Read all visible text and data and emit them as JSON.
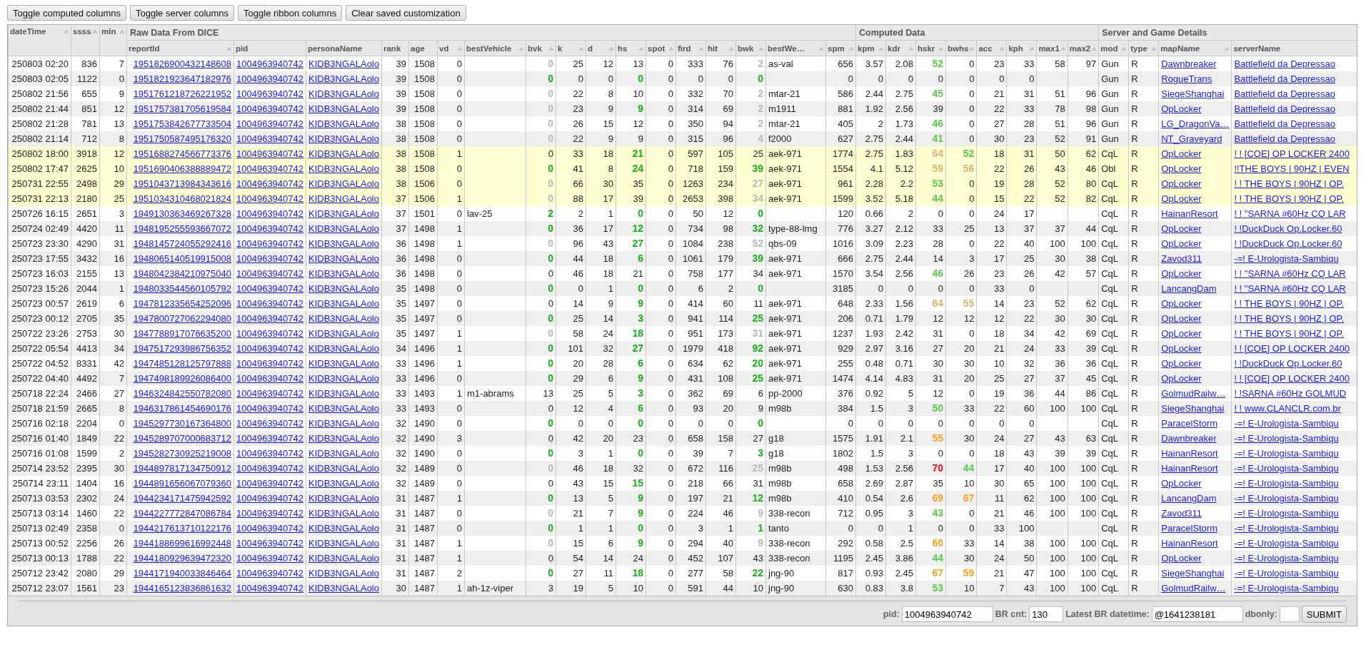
{
  "toolbar": {
    "buttons": [
      "Toggle computed columns",
      "Toggle server columns",
      "Toggle ribbon columns",
      "Clear saved customization"
    ]
  },
  "table": {
    "leading_columns": [
      {
        "label": "dateTime",
        "sortable": true,
        "kind": "number"
      },
      {
        "label": "ssss",
        "sortable": true,
        "kind": "number"
      },
      {
        "label": "min",
        "sortable": true,
        "kind": "number"
      }
    ],
    "groups": [
      {
        "label": "Raw Data From DICE",
        "columns": [
          {
            "label": "reportId",
            "sortable": true,
            "kind": "id-link"
          },
          {
            "label": "pid",
            "sortable": false,
            "kind": "link"
          },
          {
            "label": "personaName",
            "sortable": false,
            "kind": "link"
          },
          {
            "label": "rank",
            "sortable": false,
            "kind": "number"
          },
          {
            "label": "age",
            "sortable": false,
            "kind": "number"
          },
          {
            "label": "vd",
            "sortable": true,
            "kind": "number"
          },
          {
            "label": "bestVehicle",
            "sortable": true,
            "kind": "text"
          },
          {
            "label": "bvk",
            "sortable": true,
            "kind": "number"
          },
          {
            "label": "k",
            "sortable": true,
            "kind": "number"
          },
          {
            "label": "d",
            "sortable": true,
            "kind": "number"
          },
          {
            "label": "hs",
            "sortable": true,
            "kind": "number"
          },
          {
            "label": "spot",
            "sortable": true,
            "kind": "number"
          },
          {
            "label": "fird",
            "sortable": true,
            "kind": "number"
          },
          {
            "label": "hit",
            "sortable": true,
            "kind": "number"
          },
          {
            "label": "bwk",
            "sortable": true,
            "kind": "number"
          },
          {
            "label": "bestWe…",
            "sortable": true,
            "kind": "text"
          },
          {
            "label": "spm",
            "sortable": true,
            "kind": "number"
          }
        ]
      },
      {
        "label": "Computed Data",
        "columns": [
          {
            "label": "kpm",
            "sortable": true,
            "kind": "number"
          },
          {
            "label": "kdr",
            "sortable": true,
            "kind": "number"
          },
          {
            "label": "hskr",
            "sortable": true,
            "kind": "number"
          },
          {
            "label": "bwhs",
            "sortable": true,
            "kind": "number"
          },
          {
            "label": "acc",
            "sortable": true,
            "kind": "number"
          },
          {
            "label": "kph",
            "sortable": true,
            "kind": "number"
          },
          {
            "label": "max1",
            "sortable": true,
            "kind": "number"
          },
          {
            "label": "max2",
            "sortable": true,
            "kind": "number"
          }
        ]
      },
      {
        "label": "Server and Game Details",
        "columns": [
          {
            "label": "mod",
            "sortable": true,
            "kind": "text"
          },
          {
            "label": "type",
            "sortable": true,
            "kind": "text"
          },
          {
            "label": "mapName",
            "sortable": true,
            "kind": "link"
          },
          {
            "label": "serverName",
            "sortable": false,
            "kind": "link"
          }
        ]
      }
    ],
    "rows": [
      {
        "highlighted": false,
        "cells": [
          "250803 02:20",
          "836",
          "7",
          "1951826900432148608",
          "1004963940742",
          "KIDB3NGALAolo",
          "39",
          "1508",
          "0",
          null,
          {
            "text": "0",
            "color": "#b8b8b8"
          },
          "25",
          "12",
          "13",
          "0",
          "333",
          "76",
          {
            "text": "2",
            "color": "#b8b8b8"
          },
          "as-val",
          "656",
          "3.57",
          "2.08",
          {
            "text": "52",
            "color": "#5cc84e"
          },
          "0",
          "23",
          "33",
          "58",
          "97",
          "Gun",
          "R",
          "Dawnbreaker",
          "Battlefield da Depressao"
        ]
      },
      {
        "highlighted": false,
        "cells": [
          "250803 02:05",
          "1122",
          "0",
          "1951821923647182976",
          "1004963940742",
          "KIDB3NGALAolo",
          "39",
          "1508",
          "0",
          null,
          {
            "text": "0",
            "color": "#16b016"
          },
          "0",
          "0",
          {
            "text": "0",
            "color": "#16b016"
          },
          "0",
          "0",
          "0",
          {
            "text": "0",
            "color": "#16b016"
          },
          null,
          "0",
          "0",
          "0",
          "0",
          "0",
          "0",
          "0",
          null,
          null,
          "Gun",
          "R",
          "RogueTrans",
          "Battlefield da Depressao"
        ]
      },
      {
        "highlighted": false,
        "cells": [
          "250802 21:56",
          "655",
          "9",
          "1951761218726221952",
          "1004963940742",
          "KIDB3NGALAolo",
          "39",
          "1508",
          "0",
          null,
          {
            "text": "0",
            "color": "#b8b8b8"
          },
          "22",
          "8",
          "10",
          "0",
          "332",
          "70",
          {
            "text": "2",
            "color": "#b8b8b8"
          },
          "mtar-21",
          "586",
          "2.44",
          "2.75",
          {
            "text": "45",
            "color": "#5cc84e"
          },
          "0",
          "21",
          "31",
          "51",
          "96",
          "Gun",
          "R",
          "SiegeShanghai",
          "Battlefield da Depressao"
        ]
      },
      {
        "highlighted": false,
        "cells": [
          "250802 21:44",
          "851",
          "12",
          "1951757381705619584",
          "1004963940742",
          "KIDB3NGALAolo",
          "39",
          "1508",
          "0",
          null,
          {
            "text": "0",
            "color": "#b8b8b8"
          },
          "23",
          "9",
          {
            "text": "9",
            "color": "#16b016"
          },
          "0",
          "314",
          "69",
          {
            "text": "2",
            "color": "#b8b8b8"
          },
          "m1911",
          "881",
          "1.92",
          "2.56",
          "39",
          "0",
          "22",
          "33",
          "78",
          "98",
          "Gun",
          "R",
          "OpLocker",
          "Battlefield da Depressao"
        ]
      },
      {
        "highlighted": false,
        "cells": [
          "250802 21:28",
          "781",
          "13",
          "1951753842677733504",
          "1004963940742",
          "KIDB3NGALAolo",
          "38",
          "1508",
          "0",
          null,
          {
            "text": "0",
            "color": "#b8b8b8"
          },
          "26",
          "15",
          "12",
          "0",
          "350",
          "94",
          {
            "text": "2",
            "color": "#b8b8b8"
          },
          "mtar-21",
          "405",
          "2",
          "1.73",
          {
            "text": "46",
            "color": "#5cc84e"
          },
          "0",
          "27",
          "28",
          "51",
          "96",
          "Gun",
          "R",
          "LG_DragonVa…",
          "Battlefield da Depressao"
        ]
      },
      {
        "highlighted": false,
        "cells": [
          "250802 21:14",
          "712",
          "8",
          "1951750587495176320",
          "1004963940742",
          "KIDB3NGALAolo",
          "38",
          "1508",
          "0",
          null,
          {
            "text": "0",
            "color": "#b8b8b8"
          },
          "22",
          "9",
          "9",
          "0",
          "315",
          "96",
          {
            "text": "4",
            "color": "#b8b8b8"
          },
          "f2000",
          "627",
          "2.75",
          "2.44",
          {
            "text": "41",
            "color": "#5cc84e"
          },
          "0",
          "30",
          "23",
          "52",
          "91",
          "Gun",
          "R",
          "NT_Graveyard",
          "Battlefield da Depressao"
        ]
      },
      {
        "highlighted": true,
        "cells": [
          "250802 18:00",
          "3918",
          "12",
          "1951688274566773376",
          "1004963940742",
          "KIDB3NGALAolo",
          "38",
          "1508",
          "1",
          null,
          "0",
          "33",
          "18",
          {
            "text": "21",
            "color": "#16b016"
          },
          "0",
          "597",
          "105",
          "25",
          "aek-971",
          "1774",
          "2.75",
          "1.83",
          {
            "text": "64",
            "color": "#d9b473"
          },
          {
            "text": "52",
            "color": "#5cc84e"
          },
          "18",
          "31",
          "50",
          "62",
          "CqL",
          "R",
          "OpLocker",
          "! ! [COE] OP LOCKER 2400"
        ]
      },
      {
        "highlighted": true,
        "cells": [
          "250802 17:47",
          "2625",
          "10",
          "1951690406388889472",
          "1004963940742",
          "KIDB3NGALAolo",
          "38",
          "1508",
          "0",
          null,
          {
            "text": "0",
            "color": "#16b016"
          },
          "41",
          "8",
          {
            "text": "24",
            "color": "#16b016"
          },
          "0",
          "718",
          "159",
          {
            "text": "39",
            "color": "#16b016"
          },
          "aek-971",
          "1554",
          "4.1",
          "5.12",
          {
            "text": "59",
            "color": "#d9b473"
          },
          {
            "text": "56",
            "color": "#d9b473"
          },
          "22",
          "26",
          "43",
          "46",
          "Obl",
          "R",
          "OpLocker",
          "!!THE BOYS | 90HZ | EVEN"
        ]
      },
      {
        "highlighted": true,
        "cells": [
          "250731 22:55",
          "2498",
          "29",
          "1951043713984343616",
          "1004963940742",
          "KIDB3NGALAolo",
          "38",
          "1506",
          "0",
          null,
          {
            "text": "0",
            "color": "#b8b8b8"
          },
          "66",
          "30",
          "35",
          "0",
          "1263",
          "234",
          {
            "text": "27",
            "color": "#b8b8b8"
          },
          "aek-971",
          "961",
          "2.28",
          "2.2",
          {
            "text": "53",
            "color": "#5cc84e"
          },
          "0",
          "19",
          "28",
          "52",
          "80",
          "CqL",
          "R",
          "OpLocker",
          "! ! THE BOYS | 90HZ | OP."
        ]
      },
      {
        "highlighted": true,
        "cells": [
          "250731 22:13",
          "2180",
          "25",
          "1951034310468021824",
          "1004963940742",
          "KIDB3NGALAolo",
          "37",
          "1506",
          "1",
          null,
          {
            "text": "0",
            "color": "#b8b8b8"
          },
          "88",
          "17",
          "39",
          "0",
          "2653",
          "398",
          {
            "text": "34",
            "color": "#b8b8b8"
          },
          "aek-971",
          "1599",
          "3.52",
          "5.18",
          {
            "text": "44",
            "color": "#5cc84e"
          },
          "0",
          "15",
          "22",
          "52",
          "82",
          "CqL",
          "R",
          "OpLocker",
          "! ! THE BOYS | 90HZ | OP."
        ]
      },
      {
        "highlighted": false,
        "cells": [
          "250726 16:15",
          "2651",
          "3",
          "1949130363469267328",
          "1004963940742",
          "KIDB3NGALAolo",
          "37",
          "1501",
          "0",
          "lav-25",
          {
            "text": "2",
            "color": "#16b016"
          },
          "2",
          "1",
          {
            "text": "0",
            "color": "#16b016"
          },
          "0",
          "50",
          "12",
          {
            "text": "0",
            "color": "#16b016"
          },
          null,
          "120",
          "0.66",
          "2",
          "0",
          "0",
          "24",
          "17",
          null,
          null,
          "CqL",
          "R",
          "HainanResort",
          "! ! \"SARNA #60Hz CQ LAR"
        ]
      },
      {
        "highlighted": false,
        "cells": [
          "250724 02:49",
          "4420",
          "11",
          "1948195255593667072",
          "1004963940742",
          "KIDB3NGALAolo",
          "37",
          "1498",
          "1",
          null,
          {
            "text": "0",
            "color": "#16b016"
          },
          "36",
          "17",
          {
            "text": "12",
            "color": "#16b016"
          },
          "0",
          "734",
          "98",
          {
            "text": "32",
            "color": "#16b016"
          },
          "type-88-lmg",
          "776",
          "3.27",
          "2.12",
          "33",
          "25",
          "13",
          "37",
          "37",
          "44",
          "CqL",
          "R",
          "OpLocker",
          "! !DuckDuck Op.Locker.60"
        ]
      },
      {
        "highlighted": false,
        "cells": [
          "250723 23:30",
          "4290",
          "31",
          "1948145724055292416",
          "1004963940742",
          "KIDB3NGALAolo",
          "36",
          "1498",
          "1",
          null,
          {
            "text": "0",
            "color": "#b8b8b8"
          },
          "96",
          "43",
          {
            "text": "27",
            "color": "#16b016"
          },
          "0",
          "1084",
          "238",
          {
            "text": "52",
            "color": "#b8b8b8"
          },
          "qbs-09",
          "1016",
          "3.09",
          "2.23",
          "28",
          "0",
          "22",
          "40",
          "100",
          "100",
          "CqL",
          "R",
          "OpLocker",
          "! !DuckDuck Op.Locker.60"
        ]
      },
      {
        "highlighted": false,
        "cells": [
          "250723 17:55",
          "3432",
          "16",
          "1948065140519915008",
          "1004963940742",
          "KIDB3NGALAolo",
          "36",
          "1498",
          "0",
          null,
          {
            "text": "0",
            "color": "#16b016"
          },
          "44",
          "18",
          {
            "text": "6",
            "color": "#16b016"
          },
          "0",
          "1061",
          "179",
          {
            "text": "39",
            "color": "#16b016"
          },
          "aek-971",
          "666",
          "2.75",
          "2.44",
          "14",
          "3",
          "17",
          "25",
          "30",
          "38",
          "CqL",
          "R",
          "Zavod311",
          "-=! E-Urologista-Sambiqu"
        ]
      },
      {
        "highlighted": false,
        "cells": [
          "250723 16:03",
          "2155",
          "13",
          "1948042384210975040",
          "1004963940742",
          "KIDB3NGALAolo",
          "36",
          "1498",
          "0",
          null,
          "0",
          "46",
          "18",
          "21",
          "0",
          "758",
          "177",
          "34",
          "aek-971",
          "1570",
          "3.54",
          "2.56",
          {
            "text": "46",
            "color": "#5cc84e"
          },
          "26",
          "23",
          "26",
          "42",
          "57",
          "CqL",
          "R",
          "OpLocker",
          "! ! \"SARNA #60Hz CQ LAR"
        ]
      },
      {
        "highlighted": false,
        "cells": [
          "250723 15:26",
          "2044",
          "1",
          "1948033544560105792",
          "1004963940742",
          "KIDB3NGALAolo",
          "35",
          "1498",
          "0",
          null,
          {
            "text": "0",
            "color": "#16b016"
          },
          "0",
          "1",
          {
            "text": "0",
            "color": "#16b016"
          },
          "0",
          "6",
          "2",
          {
            "text": "0",
            "color": "#16b016"
          },
          null,
          "3185",
          "0",
          "0",
          "0",
          "0",
          "33",
          "0",
          null,
          null,
          "CqL",
          "R",
          "LancangDam",
          "! ! \"SARNA #60Hz CQ LAR"
        ]
      },
      {
        "highlighted": false,
        "cells": [
          "250723 00:57",
          "2619",
          "6",
          "1947812335654252096",
          "1004963940742",
          "KIDB3NGALAolo",
          "35",
          "1497",
          "0",
          null,
          "0",
          "14",
          "9",
          {
            "text": "9",
            "color": "#16b016"
          },
          "0",
          "414",
          "60",
          "11",
          "aek-971",
          "648",
          "2.33",
          "1.56",
          {
            "text": "64",
            "color": "#d9b473"
          },
          {
            "text": "55",
            "color": "#d9b473"
          },
          "14",
          "23",
          "52",
          "62",
          "CqL",
          "R",
          "OpLocker",
          "! ! THE BOYS | 90HZ | OP."
        ]
      },
      {
        "highlighted": false,
        "cells": [
          "250723 00:12",
          "2705",
          "35",
          "1947800727062294080",
          "1004963940742",
          "KIDB3NGALAolo",
          "35",
          "1497",
          "0",
          null,
          {
            "text": "0",
            "color": "#16b016"
          },
          "25",
          "14",
          {
            "text": "3",
            "color": "#16b016"
          },
          "0",
          "941",
          "114",
          {
            "text": "25",
            "color": "#16b016"
          },
          "aek-971",
          "206",
          "0.71",
          "1.79",
          "12",
          "12",
          "12",
          "22",
          "30",
          "30",
          "CqL",
          "R",
          "OpLocker",
          "! ! THE BOYS | 90HZ | OP."
        ]
      },
      {
        "highlighted": false,
        "cells": [
          "250722 23:26",
          "2753",
          "30",
          "1947788917076635200",
          "1004963940742",
          "KIDB3NGALAolo",
          "35",
          "1497",
          "1",
          null,
          {
            "text": "0",
            "color": "#b8b8b8"
          },
          "58",
          "24",
          {
            "text": "18",
            "color": "#16b016"
          },
          "0",
          "951",
          "173",
          {
            "text": "31",
            "color": "#b8b8b8"
          },
          "aek-971",
          "1237",
          "1.93",
          "2.42",
          "31",
          "0",
          "18",
          "34",
          "42",
          "69",
          "CqL",
          "R",
          "OpLocker",
          "! ! THE BOYS | 90HZ | OP."
        ]
      },
      {
        "highlighted": false,
        "cells": [
          "250722 05:54",
          "4413",
          "34",
          "1947517293986756352",
          "1004963940742",
          "KIDB3NGALAolo",
          "34",
          "1496",
          "1",
          null,
          {
            "text": "0",
            "color": "#16b016"
          },
          "101",
          "32",
          {
            "text": "27",
            "color": "#16b016"
          },
          "0",
          "1979",
          "418",
          {
            "text": "92",
            "color": "#16b016"
          },
          "aek-971",
          "929",
          "2.97",
          "3.16",
          "27",
          "20",
          "21",
          "24",
          "33",
          "39",
          "CqL",
          "R",
          "OpLocker",
          "! ! [COE] OP LOCKER 2400"
        ]
      },
      {
        "highlighted": false,
        "cells": [
          "250722 04:52",
          "8331",
          "42",
          "1947485128125797888",
          "1004963940742",
          "KIDB3NGALAolo",
          "33",
          "1496",
          "1",
          null,
          {
            "text": "0",
            "color": "#16b016"
          },
          "20",
          "28",
          {
            "text": "6",
            "color": "#16b016"
          },
          "0",
          "634",
          "62",
          {
            "text": "20",
            "color": "#16b016"
          },
          "aek-971",
          "255",
          "0.48",
          "0.71",
          "30",
          "30",
          "10",
          "32",
          "36",
          "36",
          "CqL",
          "R",
          "OpLocker",
          "! !DuckDuck Op.Locker.60"
        ]
      },
      {
        "highlighted": false,
        "cells": [
          "250722 04:40",
          "4492",
          "7",
          "1947498189926086400",
          "1004963940742",
          "KIDB3NGALAolo",
          "33",
          "1496",
          "0",
          null,
          {
            "text": "0",
            "color": "#16b016"
          },
          "29",
          "6",
          {
            "text": "9",
            "color": "#16b016"
          },
          "0",
          "431",
          "108",
          {
            "text": "25",
            "color": "#16b016"
          },
          "aek-971",
          "1474",
          "4.14",
          "4.83",
          "31",
          "20",
          "25",
          "27",
          "37",
          "45",
          "CqL",
          "R",
          "OpLocker",
          "! ! [COE] OP LOCKER 2400"
        ]
      },
      {
        "highlighted": false,
        "cells": [
          "250718 22:24",
          "2466",
          "27",
          "1946324842550782080",
          "1004963940742",
          "KIDB3NGALAolo",
          "33",
          "1493",
          "1",
          "m1-abrams",
          "13",
          "25",
          "5",
          {
            "text": "3",
            "color": "#16b016"
          },
          "0",
          "362",
          "69",
          "6",
          "pp-2000",
          "376",
          "0.92",
          "5",
          "12",
          "0",
          "19",
          "36",
          "44",
          "86",
          "CqL",
          "R",
          "GolmudRailw…",
          "! !SARNA #60Hz GOLMUD"
        ]
      },
      {
        "highlighted": false,
        "cells": [
          "250718 21:59",
          "2665",
          "8",
          "1946317861454690176",
          "1004963940742",
          "KIDB3NGALAolo",
          "33",
          "1493",
          "0",
          null,
          "0",
          "12",
          "4",
          {
            "text": "6",
            "color": "#16b016"
          },
          "0",
          "93",
          "20",
          "9",
          "m98b",
          "384",
          "1.5",
          "3",
          {
            "text": "50",
            "color": "#5cc84e"
          },
          "33",
          "22",
          "60",
          "100",
          "100",
          "CqL",
          "R",
          "SiegeShanghai",
          "! ! www.CLANCLR.com.br"
        ]
      },
      {
        "highlighted": false,
        "cells": [
          "250716 02:18",
          "2204",
          "0",
          "1945297730167364800",
          "1004963940742",
          "KIDB3NGALAolo",
          "32",
          "1490",
          "0",
          null,
          {
            "text": "0",
            "color": "#16b016"
          },
          "0",
          "0",
          {
            "text": "0",
            "color": "#16b016"
          },
          "0",
          "0",
          "0",
          {
            "text": "0",
            "color": "#16b016"
          },
          null,
          "0",
          "0",
          "0",
          "0",
          "0",
          "0",
          "0",
          null,
          null,
          "CqL",
          "R",
          "ParacelStorm",
          "-=! E-Urologista-Sambiqu"
        ]
      },
      {
        "highlighted": false,
        "cells": [
          "250716 01:40",
          "1849",
          "22",
          "1945289707000683712",
          "1004963940742",
          "KIDB3NGALAolo",
          "32",
          "1490",
          "3",
          null,
          "0",
          "42",
          "20",
          "23",
          "0",
          "658",
          "158",
          "27",
          "g18",
          "1575",
          "1.91",
          "2.1",
          {
            "text": "55",
            "color": "#f7a21b"
          },
          "30",
          "24",
          "27",
          "43",
          "63",
          "CqL",
          "R",
          "Dawnbreaker",
          "-=! E-Urologista-Sambiqu"
        ]
      },
      {
        "highlighted": false,
        "cells": [
          "250716 01:08",
          "1599",
          "2",
          "1945282730925219008",
          "1004963940742",
          "KIDB3NGALAolo",
          "32",
          "1490",
          "0",
          null,
          {
            "text": "0",
            "color": "#16b016"
          },
          "3",
          "1",
          {
            "text": "0",
            "color": "#16b016"
          },
          "0",
          "39",
          "7",
          {
            "text": "3",
            "color": "#16b016"
          },
          "g18",
          "1802",
          "1.5",
          "3",
          "0",
          "0",
          "18",
          "43",
          "39",
          "39",
          "CqL",
          "R",
          "HainanResort",
          "-=! E-Urologista-Sambiqu"
        ]
      },
      {
        "highlighted": false,
        "cells": [
          "250714 23:52",
          "2395",
          "30",
          "1944897817134750912",
          "1004963940742",
          "KIDB3NGALAolo",
          "32",
          "1489",
          "0",
          null,
          {
            "text": "0",
            "color": "#b8b8b8"
          },
          "46",
          "18",
          "32",
          "0",
          "672",
          "116",
          {
            "text": "25",
            "color": "#b8b8b8"
          },
          "m98b",
          "498",
          "1.53",
          "2.56",
          {
            "text": "70",
            "color": "#ee1111"
          },
          {
            "text": "44",
            "color": "#5cc84e"
          },
          "17",
          "40",
          "100",
          "100",
          "CqL",
          "R",
          "HainanResort",
          "-=! E-Urologista-Sambiqu"
        ]
      },
      {
        "highlighted": false,
        "cells": [
          "250714 23:11",
          "1404",
          "16",
          "1944891656067079360",
          "1004963940742",
          "KIDB3NGALAolo",
          "32",
          "1489",
          "0",
          null,
          "0",
          "43",
          "15",
          {
            "text": "15",
            "color": "#16b016"
          },
          "0",
          "218",
          "66",
          "31",
          "m98b",
          "658",
          "2.69",
          "2.87",
          "35",
          "10",
          "30",
          "65",
          "100",
          "100",
          "CqL",
          "R",
          "OpLocker",
          "-=! E-Urologista-Sambiqu"
        ]
      },
      {
        "highlighted": false,
        "cells": [
          "250713 03:53",
          "2302",
          "24",
          "1944234171475942592",
          "1004963940742",
          "KIDB3NGALAolo",
          "31",
          "1487",
          "1",
          null,
          {
            "text": "0",
            "color": "#16b016"
          },
          "13",
          "5",
          {
            "text": "9",
            "color": "#16b016"
          },
          "0",
          "197",
          "21",
          {
            "text": "12",
            "color": "#16b016"
          },
          "m98b",
          "410",
          "0.54",
          "2.6",
          {
            "text": "69",
            "color": "#f7a21b"
          },
          {
            "text": "67",
            "color": "#f7a21b"
          },
          "11",
          "62",
          "100",
          "100",
          "CqL",
          "R",
          "LancangDam",
          "-=! E-Urologista-Sambiqu"
        ]
      },
      {
        "highlighted": false,
        "cells": [
          "250713 03:14",
          "1460",
          "22",
          "1944227772847086784",
          "1004963940742",
          "KIDB3NGALAolo",
          "31",
          "1487",
          "0",
          null,
          {
            "text": "0",
            "color": "#b8b8b8"
          },
          "21",
          "7",
          {
            "text": "9",
            "color": "#16b016"
          },
          "0",
          "224",
          "46",
          {
            "text": "9",
            "color": "#b8b8b8"
          },
          "338-recon",
          "712",
          "0.95",
          "3",
          {
            "text": "43",
            "color": "#5cc84e"
          },
          "0",
          "21",
          "46",
          "100",
          "100",
          "CqL",
          "R",
          "Zavod311",
          "-=! E-Urologista-Sambiqu"
        ]
      },
      {
        "highlighted": false,
        "cells": [
          "250713 02:49",
          "2358",
          "0",
          "1944217613710122176",
          "1004963940742",
          "KIDB3NGALAolo",
          "31",
          "1487",
          "0",
          null,
          {
            "text": "0",
            "color": "#16b016"
          },
          "1",
          "1",
          {
            "text": "0",
            "color": "#16b016"
          },
          "0",
          "3",
          "1",
          {
            "text": "1",
            "color": "#16b016"
          },
          "tanto",
          "0",
          "0",
          "1",
          "0",
          "0",
          "33",
          "100",
          null,
          null,
          "CqL",
          "R",
          "ParacelStorm",
          "-=! E-Urologista-Sambiqu"
        ]
      },
      {
        "highlighted": false,
        "cells": [
          "250713 00:52",
          "2256",
          "26",
          "1944188699616992448",
          "1004963940742",
          "KIDB3NGALAolo",
          "31",
          "1487",
          "1",
          null,
          {
            "text": "0",
            "color": "#b8b8b8"
          },
          "15",
          "6",
          {
            "text": "9",
            "color": "#16b016"
          },
          "0",
          "294",
          "40",
          {
            "text": "9",
            "color": "#b8b8b8"
          },
          "338-recon",
          "292",
          "0.58",
          "2.5",
          {
            "text": "60",
            "color": "#f7a21b"
          },
          "33",
          "14",
          "38",
          "100",
          "100",
          "CqL",
          "R",
          "HainanResort",
          "-=! E-Urologista-Sambiqu"
        ]
      },
      {
        "highlighted": false,
        "cells": [
          "250713 00:13",
          "1788",
          "22",
          "1944180929639472320",
          "1004963940742",
          "KIDB3NGALAolo",
          "31",
          "1487",
          "1",
          null,
          "0",
          "54",
          "14",
          "24",
          "0",
          "452",
          "107",
          "43",
          "338-recon",
          "1195",
          "2.45",
          "3.86",
          {
            "text": "44",
            "color": "#5cc84e"
          },
          "30",
          "24",
          "50",
          "100",
          "100",
          "CqL",
          "R",
          "OpLocker",
          "-=! E-Urologista-Sambiqu"
        ]
      },
      {
        "highlighted": false,
        "cells": [
          "250712 23:42",
          "2080",
          "29",
          "1944171940033846464",
          "1004963940742",
          "KIDB3NGALAolo",
          "31",
          "1487",
          "2",
          null,
          {
            "text": "0",
            "color": "#16b016"
          },
          "27",
          "11",
          {
            "text": "18",
            "color": "#16b016"
          },
          "0",
          "277",
          "58",
          {
            "text": "22",
            "color": "#16b016"
          },
          "jng-90",
          "817",
          "0.93",
          "2.45",
          {
            "text": "67",
            "color": "#f7a21b"
          },
          {
            "text": "59",
            "color": "#f7a21b"
          },
          "21",
          "47",
          "100",
          "100",
          "CqL",
          "R",
          "SiegeShanghai",
          "-=! E-Urologista-Sambiqu"
        ]
      },
      {
        "highlighted": false,
        "cells": [
          "250712 23:07",
          "1561",
          "23",
          "1944165123836861632",
          "1004963940742",
          "KIDB3NGALAolo",
          "30",
          "1487",
          "1",
          "ah-1z-viper",
          "3",
          "19",
          "5",
          "10",
          "0",
          "591",
          "44",
          "10",
          "jng-90",
          "630",
          "0.83",
          "3.8",
          {
            "text": "53",
            "color": "#5cc84e"
          },
          "10",
          "7",
          "43",
          "100",
          "100",
          "CqL",
          "R",
          "GolmudRailw…",
          "-=! E-Urologista-Sambiqu"
        ]
      }
    ]
  },
  "footer": {
    "fields": [
      {
        "label": "pid:",
        "value": "1004963940742"
      },
      {
        "label": "BR cnt:",
        "value": "130"
      },
      {
        "label": "Latest BR datetime:",
        "value": "@1641238181"
      },
      {
        "label": "dbonly:"
      }
    ],
    "submit": "SUBMIT"
  }
}
